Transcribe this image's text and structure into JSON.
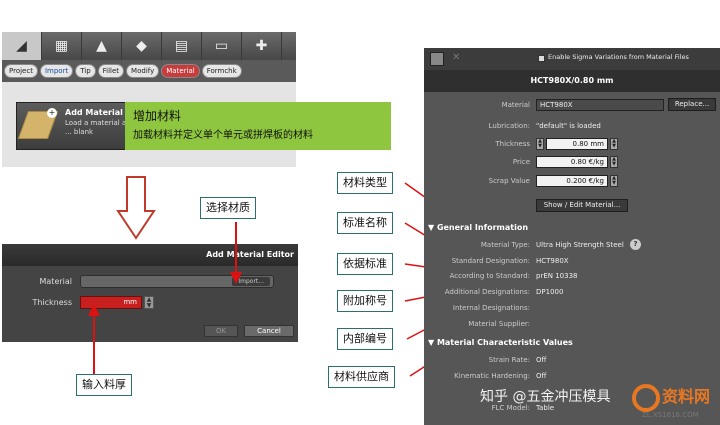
{
  "toolbar": {
    "tabs": [
      "Project",
      "Import",
      "Tip",
      "Fillet",
      "Modify",
      "Material",
      "Formchk"
    ],
    "add_material_title": "Add Material",
    "add_material_desc": "Load a material and ... blank",
    "icon_names": [
      "part-icon",
      "mesh-icon",
      "die-icon",
      "blank-icon",
      "report-icon",
      "display-icon",
      "tools-icon"
    ]
  },
  "green_callout": {
    "line1": "增加材料",
    "line2": "加载材料并定义单个单元或拼焊板的材料"
  },
  "editor": {
    "title": "Add Material Editor",
    "material_label": "Material",
    "import_label": "Import...",
    "thickness_label": "Thickness",
    "thickness_unit": "mm",
    "ok_label": "OK",
    "cancel_label": "Cancel"
  },
  "callouts": {
    "select_material": "选择材质",
    "input_thickness": "输入料厚",
    "material_type": "材料类型",
    "standard_name": "标准名称",
    "per_standard": "依据标准",
    "additional": "附加称号",
    "internal_no": "内部编号",
    "supplier": "材料供应商"
  },
  "panel": {
    "enable_sigma": "Enable Sigma Variations from Material Files",
    "header": "HCT980X/0.80 mm",
    "material_label": "Material",
    "material_value": "HCT980X",
    "replace_label": "Replace...",
    "lubrication_label": "Lubrication:",
    "lubrication_value": "\"default\" is loaded",
    "thickness_label": "Thickness",
    "thickness_value": "0.80 mm",
    "price_label": "Price",
    "price_value": "0.80 €/kg",
    "scrap_label": "Scrap Value",
    "scrap_value": "0.200 €/kg",
    "show_edit": "Show / Edit Material...",
    "general_info": "General Information",
    "material_type_label": "Material Type:",
    "material_type_value": "Ultra High Strength Steel",
    "std_designation_label": "Standard Designation:",
    "std_designation_value": "HCT980X",
    "according_label": "According to Standard:",
    "according_value": "prEN 10338",
    "additional_label": "Additional Designations:",
    "additional_value": "DP1000",
    "internal_label": "Internal Designations:",
    "supplier_label": "Material Supplier:",
    "char_values": "Material Characteristic Values",
    "strain_rate_label": "Strain Rate:",
    "strain_rate_value": "Off",
    "kinematic_label": "Kinematic Hardening:",
    "kinematic_value": "Off",
    "flc_label": "FLC Model:",
    "flc_value": "Table"
  },
  "watermark": {
    "text": "知乎 @五金冲压模具",
    "logo_text": "资料网",
    "logo_url": "ZL.XS1616.COM"
  }
}
